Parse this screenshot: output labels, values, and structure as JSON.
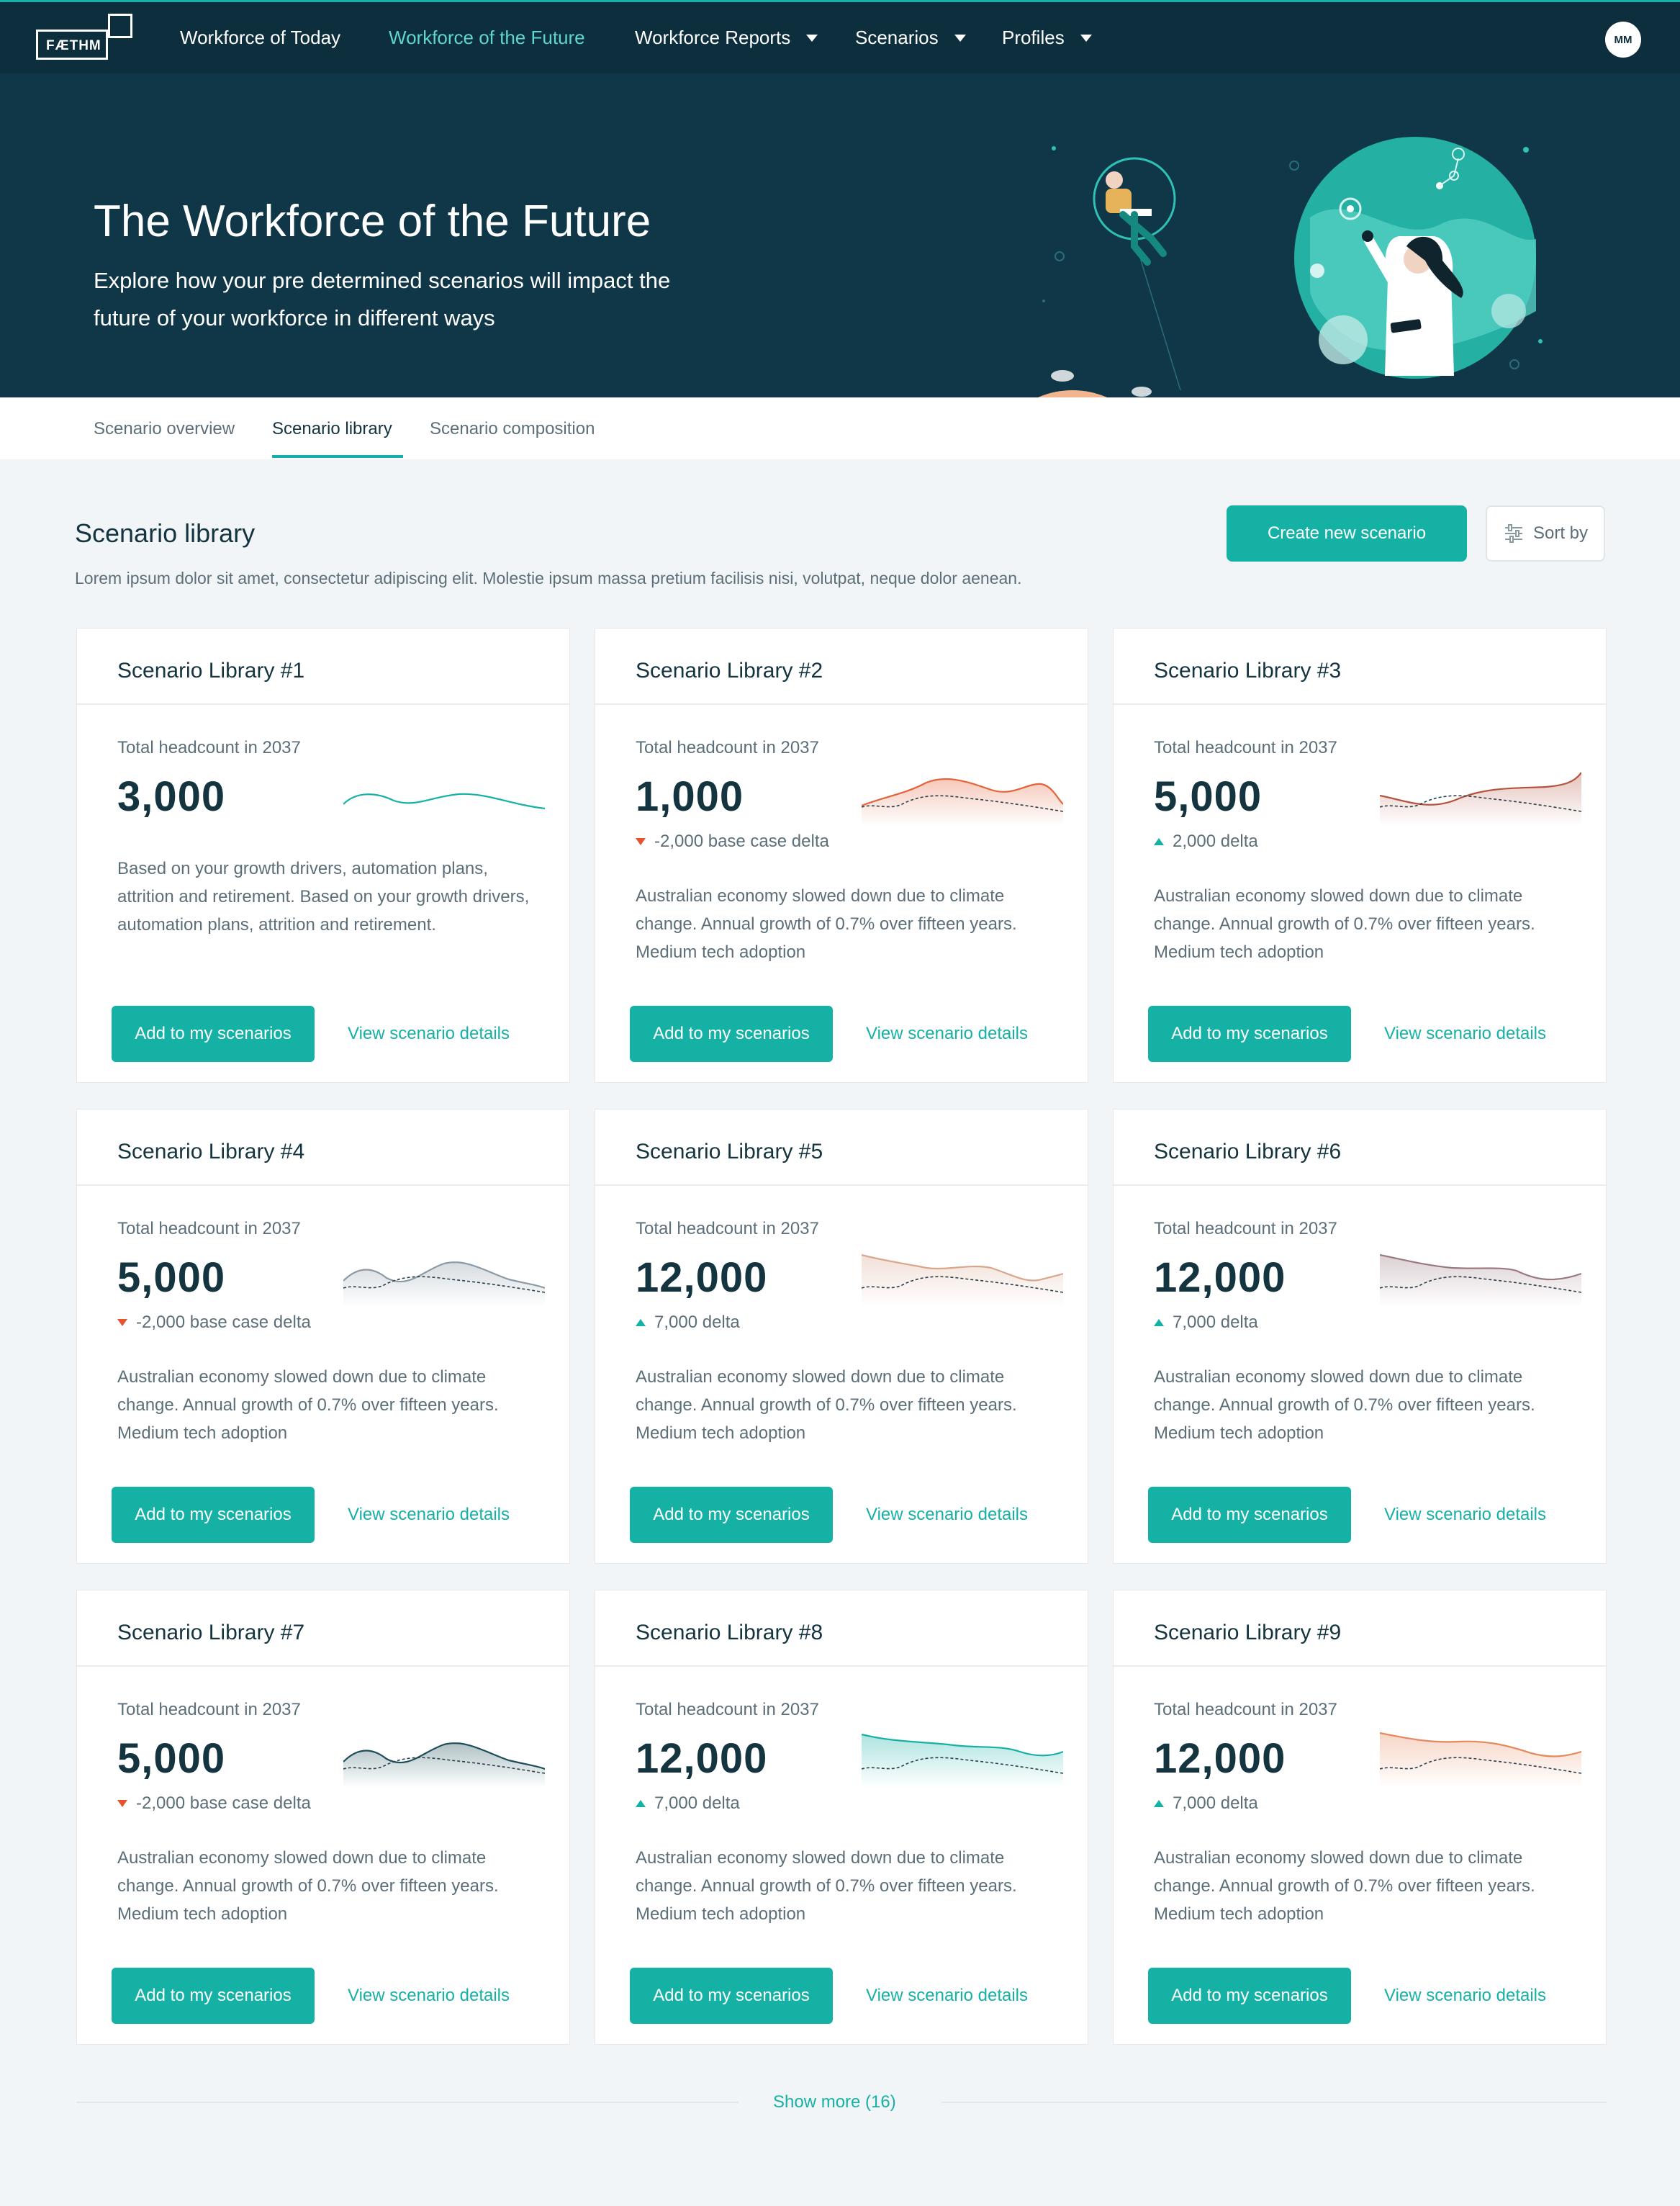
{
  "brand": {
    "logo_text": "FÆTHM",
    "accent": "#16b1a5",
    "nav_bg": "#0d2e3c",
    "hero_bg": "#0f3747"
  },
  "nav": {
    "items": [
      {
        "label": "Workforce of Today"
      },
      {
        "label": "Workforce of the Future"
      },
      {
        "label": "Workforce Reports"
      },
      {
        "label": "Scenarios"
      },
      {
        "label": "Profiles"
      }
    ],
    "avatar_initials": "MM"
  },
  "hero": {
    "title": "The Workforce of the Future",
    "subtitle": "Explore how your pre determined scenarios will impact the future of your workforce in different ways"
  },
  "tabs": [
    {
      "label": "Scenario overview"
    },
    {
      "label": "Scenario library"
    },
    {
      "label": "Scenario composition"
    }
  ],
  "section": {
    "title": "Scenario library",
    "description": "Lorem ipsum dolor sit amet, consectetur adipiscing elit. Molestie ipsum massa pretium facilisis nisi, volutpat, neque dolor aenean.",
    "create_button": "Create new scenario",
    "sort_button": "Sort by"
  },
  "cards": [
    {
      "title": "Scenario Library #1",
      "metric_label": "Total headcount in 2037",
      "value": "3,000",
      "delta": "",
      "delta_dir": "",
      "description": "Based on your growth drivers, automation plans, attrition and retirement. Based on your growth drivers, automation plans, attrition and retirement.",
      "add_label": "Add to my scenarios",
      "view_label": "View scenario details",
      "spark_color": "#16b1a5"
    },
    {
      "title": "Scenario Library #2",
      "metric_label": "Total headcount in 2037",
      "value": "1,000",
      "delta": "-2,000 base case delta",
      "delta_dir": "down",
      "description": "Australian economy slowed down due to climate change. Annual growth of 0.7% over fifteen years. Medium tech adoption",
      "add_label": "Add to my scenarios",
      "view_label": "View scenario details",
      "spark_color": "#e5633a"
    },
    {
      "title": "Scenario Library #3",
      "metric_label": "Total headcount in 2037",
      "value": "5,000",
      "delta": "2,000 delta",
      "delta_dir": "up",
      "description": "Australian economy slowed down due to climate change. Annual growth of 0.7% over fifteen years. Medium tech adoption",
      "add_label": "Add to my scenarios",
      "view_label": "View scenario details",
      "spark_color": "#b5533e"
    },
    {
      "title": "Scenario Library #4",
      "metric_label": "Total headcount in 2037",
      "value": "5,000",
      "delta": "-2,000 base case delta",
      "delta_dir": "down",
      "description": "Australian economy slowed down due to climate change. Annual growth of 0.7% over fifteen years. Medium tech adoption",
      "add_label": "Add to my scenarios",
      "view_label": "View scenario details",
      "spark_color": "#8a9aa6"
    },
    {
      "title": "Scenario Library #5",
      "metric_label": "Total headcount in 2037",
      "value": "12,000",
      "delta": "7,000 delta",
      "delta_dir": "up",
      "description": "Australian economy slowed down due to climate change. Annual growth of 0.7% over fifteen years. Medium tech adoption",
      "add_label": "Add to my scenarios",
      "view_label": "View scenario details",
      "spark_color": "#d9a68c"
    },
    {
      "title": "Scenario Library #6",
      "metric_label": "Total headcount in 2037",
      "value": "12,000",
      "delta": "7,000 delta",
      "delta_dir": "up",
      "description": "Australian economy slowed down due to climate change. Annual growth of 0.7% over fifteen years. Medium tech adoption",
      "add_label": "Add to my scenarios",
      "view_label": "View scenario details",
      "spark_color": "#9a7a82"
    },
    {
      "title": "Scenario Library #7",
      "metric_label": "Total headcount in 2037",
      "value": "5,000",
      "delta": "-2,000 base case delta",
      "delta_dir": "down",
      "description": "Australian economy slowed down due to climate change. Annual growth of 0.7% over fifteen years. Medium tech adoption",
      "add_label": "Add to my scenarios",
      "view_label": "View scenario details",
      "spark_color": "#1d4e5a"
    },
    {
      "title": "Scenario Library #8",
      "metric_label": "Total headcount in 2037",
      "value": "12,000",
      "delta": "7,000 delta",
      "delta_dir": "up",
      "description": "Australian economy slowed down due to climate change. Annual growth of 0.7% over fifteen years. Medium tech adoption",
      "add_label": "Add to my scenarios",
      "view_label": "View scenario details",
      "spark_color": "#16b1a5"
    },
    {
      "title": "Scenario Library #9",
      "metric_label": "Total headcount in 2037",
      "value": "12,000",
      "delta": "7,000 delta",
      "delta_dir": "up",
      "description": "Australian economy slowed down due to climate change. Annual growth of 0.7% over fifteen years. Medium tech adoption",
      "add_label": "Add to my scenarios",
      "view_label": "View scenario details",
      "spark_color": "#e5895e"
    }
  ],
  "footer": {
    "show_more": "Show more (16)"
  }
}
